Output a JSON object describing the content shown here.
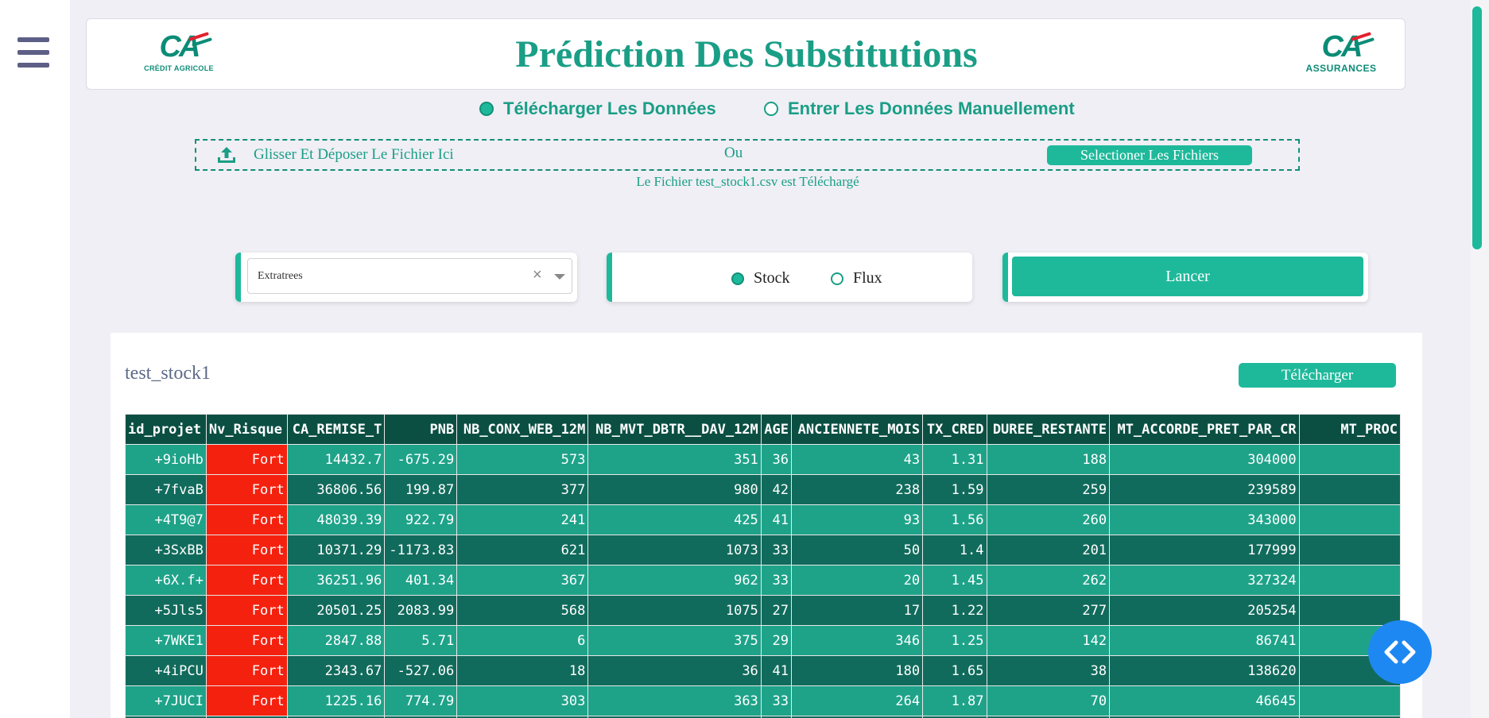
{
  "sidebar": {
    "menu_icon": "hamburger-menu-icon"
  },
  "header": {
    "title": "Prédiction Des Substitutions",
    "logo_left": {
      "mark": "CA",
      "caption": "CRÉDIT AGRICOLE"
    },
    "logo_right": {
      "mark": "CA",
      "caption": "ASSURANCES"
    }
  },
  "mode": {
    "options": [
      {
        "label": "Télécharger Les Données",
        "checked": true
      },
      {
        "label": "Entrer Les Données Manuellement",
        "checked": false
      }
    ]
  },
  "upload": {
    "icon": "upload-icon",
    "drop_text": "Glisser Et Déposer Le Fichier Ici",
    "or_text": "Ou",
    "select_button": "Selectioner Les Fichiers",
    "status": "Le Fichier test_stock1.csv est Téléchargé"
  },
  "controls": {
    "select_value": "Extratrees",
    "clear_glyph": "×",
    "type_options": [
      {
        "label": "Stock",
        "checked": true
      },
      {
        "label": "Flux",
        "checked": false
      }
    ],
    "run_button": "Lancer"
  },
  "table": {
    "name": "test_stock1",
    "download_button": "Télécharger",
    "columns": [
      "id_projet",
      "Nv_Risque",
      "CA_REMISE_T",
      "PNB",
      "NB_CONX_WEB_12M",
      "NB_MVT_DBTR__DAV_12M",
      "AGE",
      "ANCIENNETE_MOIS",
      "TX_CRED",
      "DUREE_RESTANTE",
      "MT_ACCORDE_PRET_PAR_CR",
      "MT_PROC"
    ],
    "rows": [
      [
        "+9ioHb",
        "Fort",
        "14432.7",
        "-675.29",
        "573",
        "351",
        "36",
        "43",
        "1.31",
        "188",
        "304000",
        ""
      ],
      [
        "+7fvaB",
        "Fort",
        "36806.56",
        "199.87",
        "377",
        "980",
        "42",
        "238",
        "1.59",
        "259",
        "239589",
        ""
      ],
      [
        "+4T9@7",
        "Fort",
        "48039.39",
        "922.79",
        "241",
        "425",
        "41",
        "93",
        "1.56",
        "260",
        "343000",
        ""
      ],
      [
        "+3SxBB",
        "Fort",
        "10371.29",
        "-1173.83",
        "621",
        "1073",
        "33",
        "50",
        "1.4",
        "201",
        "177999",
        ""
      ],
      [
        "+6X.f+",
        "Fort",
        "36251.96",
        "401.34",
        "367",
        "962",
        "33",
        "20",
        "1.45",
        "262",
        "327324",
        ""
      ],
      [
        "+5Jls5",
        "Fort",
        "20501.25",
        "2083.99",
        "568",
        "1075",
        "27",
        "17",
        "1.22",
        "277",
        "205254",
        ""
      ],
      [
        "+7WKE1",
        "Fort",
        "2847.88",
        "5.71",
        "6",
        "375",
        "29",
        "346",
        "1.25",
        "142",
        "86741",
        ""
      ],
      [
        "+4iPCU",
        "Fort",
        "2343.67",
        "-527.06",
        "18",
        "36",
        "41",
        "180",
        "1.65",
        "38",
        "138620",
        ""
      ],
      [
        "+7JUCI",
        "Fort",
        "1225.16",
        "774.79",
        "303",
        "363",
        "33",
        "264",
        "1.87",
        "70",
        "46645",
        ""
      ],
      [
        "",
        "",
        "",
        "",
        "",
        "",
        "",
        "",
        "",
        "",
        "",
        ""
      ]
    ]
  },
  "fab": {
    "icon": "code-brackets-icon"
  },
  "colors": {
    "accent": "#1eb99b",
    "title": "#1a9e86",
    "row_light": "#1ea389",
    "row_dark": "#116b5c",
    "header_bg": "#0b4f43",
    "risk_fort": "#f5210f",
    "fab": "#1e88f2",
    "background": "#efeff5"
  }
}
